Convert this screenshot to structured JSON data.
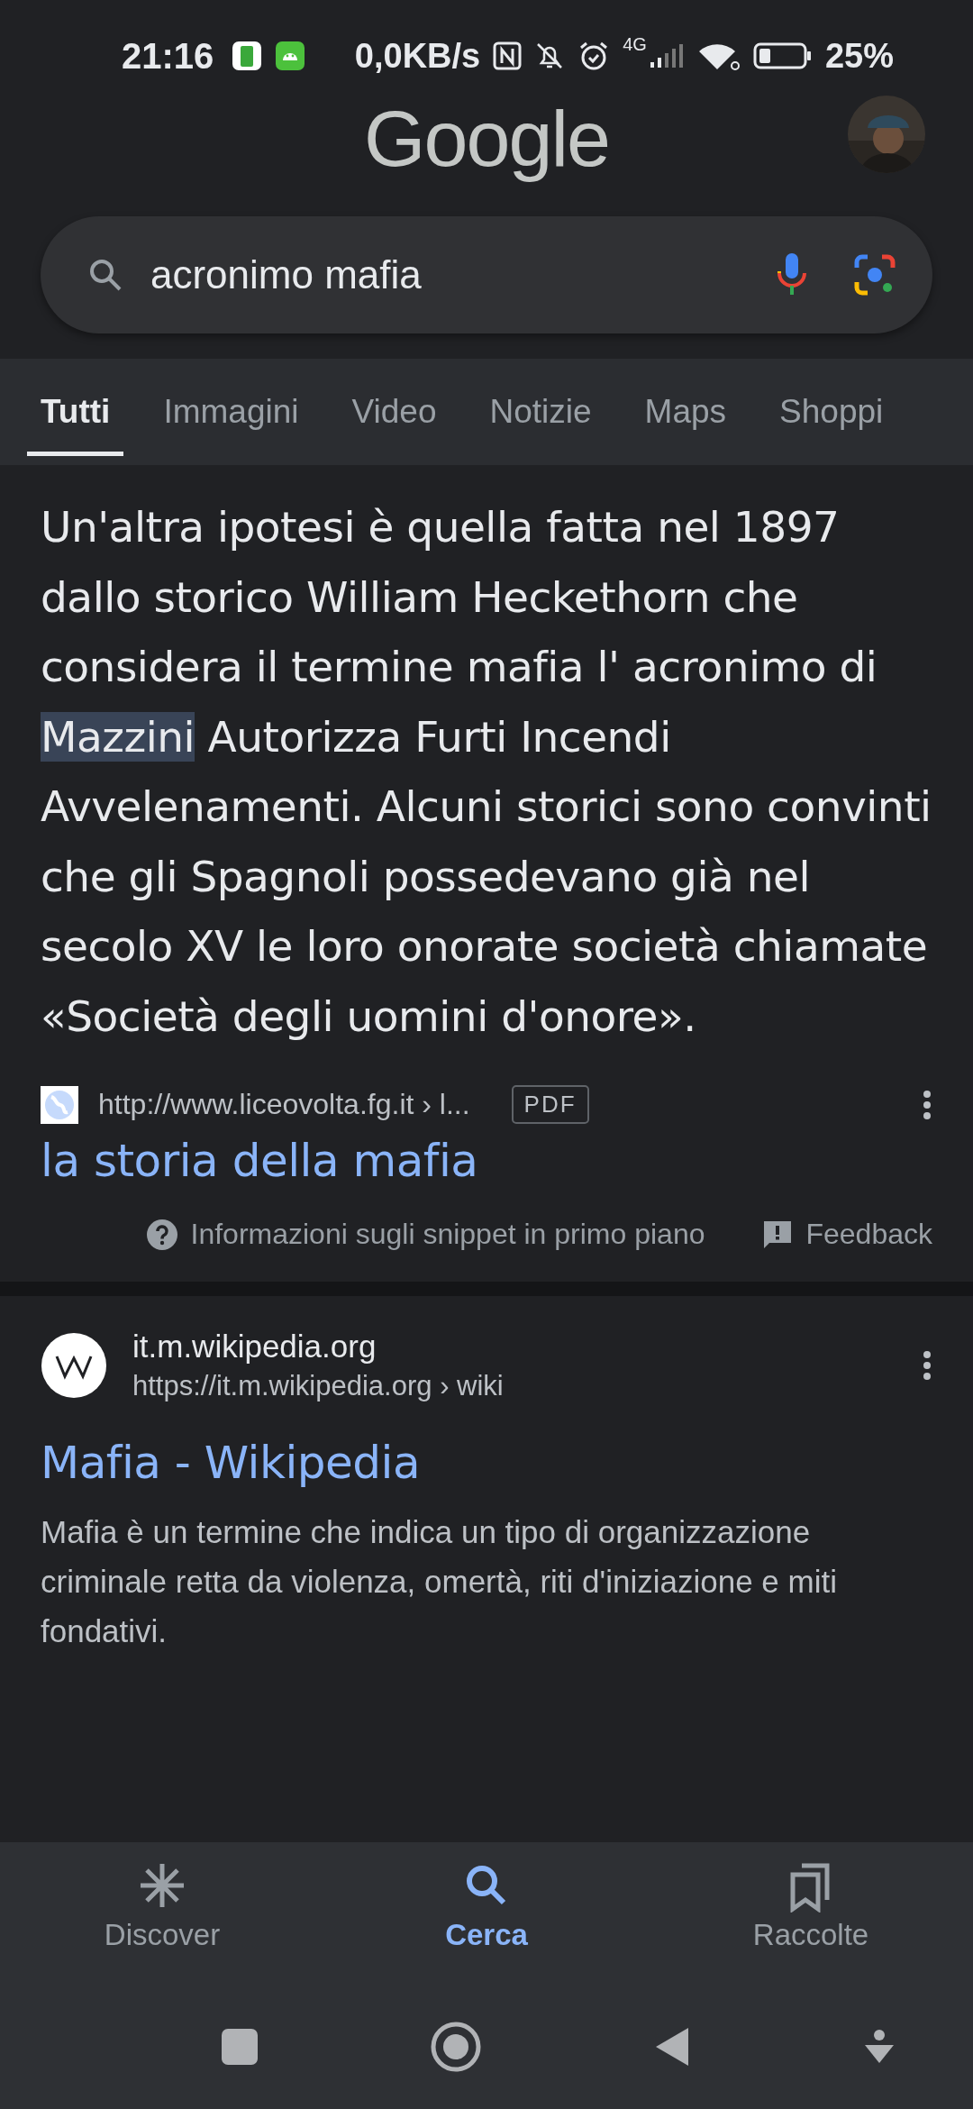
{
  "status_bar": {
    "time": "21:16",
    "speed": "0,0KB/s",
    "network": "4G",
    "battery": "25%"
  },
  "header": {
    "logo": "Google"
  },
  "search": {
    "value": "acronimo mafia"
  },
  "tabs": [
    {
      "label": "Tutti",
      "selected": true
    },
    {
      "label": "Immagini",
      "selected": false
    },
    {
      "label": "Video",
      "selected": false
    },
    {
      "label": "Notizie",
      "selected": false
    },
    {
      "label": "Maps",
      "selected": false
    },
    {
      "label": "Shoppi",
      "selected": false
    }
  ],
  "featured_snippet": {
    "before": "Un'altra ipotesi è quella fatta nel 1897 dallo storico William Heckethorn che considera il termine mafia l' acronimo di",
    "highlight": "Mazzini",
    "after": "Autorizza Furti Incendi Avvelenamenti. Alcuni storici sono convinti che gli Spagnoli possedevano già nel secolo XV le loro onorate società chiamate «Società degli uomini d'onore».",
    "url": "http://www.liceovolta.fg.it › l...",
    "badge": "PDF",
    "title": "la storia della mafia",
    "info": "Informazioni sugli snippet in primo piano",
    "feedback": "Feedback"
  },
  "results": [
    {
      "site": "it.m.wikipedia.org",
      "url": "https://it.m.wikipedia.org › wiki",
      "title": "Mafia - Wikipedia",
      "snippet": "Mafia è un termine che indica un tipo di organizzazione criminale retta da violenza, omertà, riti d'iniziazione e miti fondativi."
    }
  ],
  "bottom_nav": [
    {
      "label": "Discover",
      "kind": "discover",
      "selected": false
    },
    {
      "label": "Cerca",
      "kind": "search",
      "selected": true
    },
    {
      "label": "Raccolte",
      "kind": "collections",
      "selected": false
    }
  ]
}
